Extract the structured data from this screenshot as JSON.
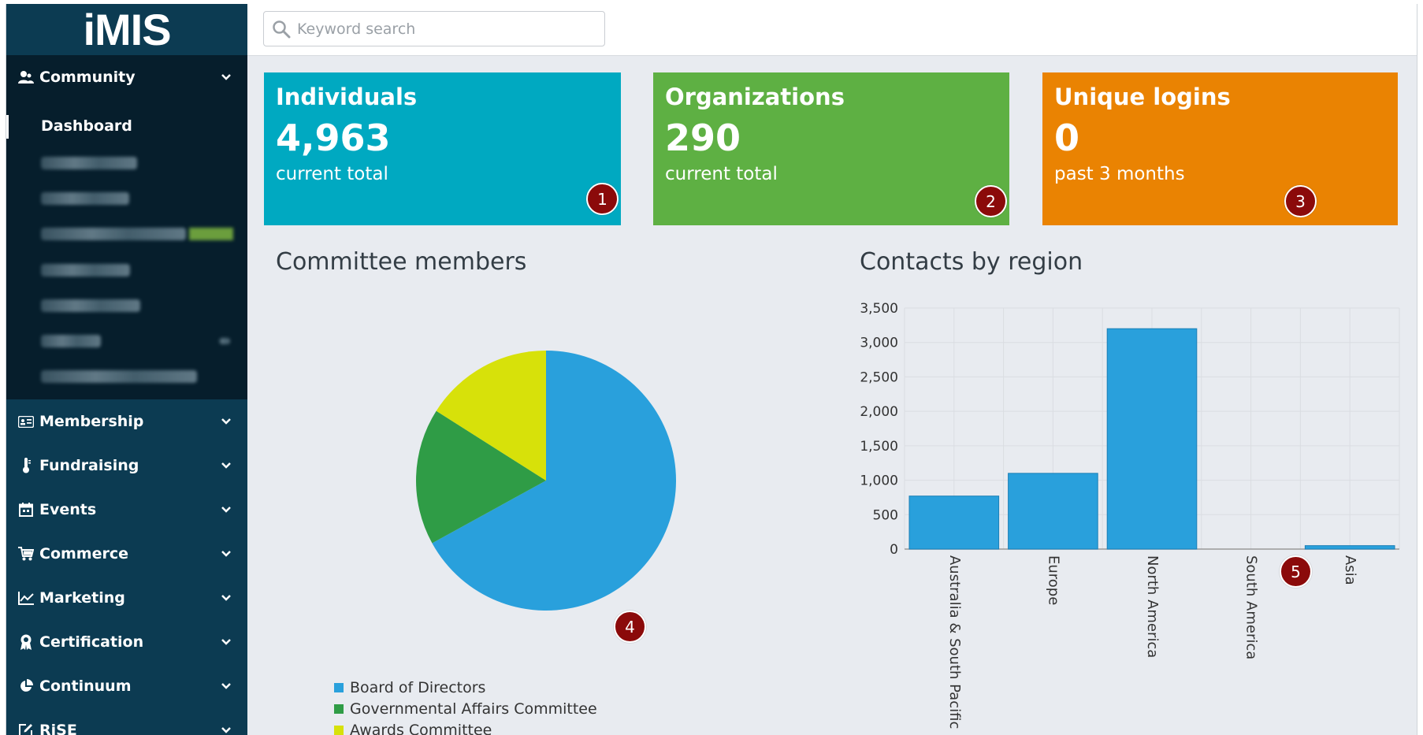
{
  "app": {
    "logo": "iMIS"
  },
  "search": {
    "placeholder": "Keyword search"
  },
  "sidebar": {
    "sections": [
      {
        "label": "Community",
        "icon": "community-icon"
      },
      {
        "label": "Membership",
        "icon": "id-card-icon"
      },
      {
        "label": "Fundraising",
        "icon": "thermometer-icon"
      },
      {
        "label": "Events",
        "icon": "calendar-icon"
      },
      {
        "label": "Commerce",
        "icon": "cart-icon"
      },
      {
        "label": "Marketing",
        "icon": "line-chart-icon"
      },
      {
        "label": "Certification",
        "icon": "award-icon"
      },
      {
        "label": "Continuum",
        "icon": "pie-icon"
      },
      {
        "label": "RiSE",
        "icon": "edit-icon"
      }
    ],
    "community_items": {
      "active": "Dashboard"
    }
  },
  "cards": [
    {
      "title": "Individuals",
      "value": "4,963",
      "subtitle": "current total",
      "color": "#00a9c1",
      "marker": "1"
    },
    {
      "title": "Organizations",
      "value": "290",
      "subtitle": "current total",
      "color": "#5eb043",
      "marker": "2"
    },
    {
      "title": "Unique logins",
      "value": "0",
      "subtitle": "past 3 months",
      "color": "#ea8302",
      "marker": "3"
    }
  ],
  "committee": {
    "title": "Committee members",
    "marker": "4",
    "legend": [
      "Board of Directors",
      "Governmental Affairs Committee",
      "Awards Committee"
    ]
  },
  "region": {
    "title": "Contacts by region",
    "marker": "5"
  },
  "chart_data": [
    {
      "type": "pie",
      "title": "Committee members",
      "categories": [
        "Board of Directors",
        "Governmental Affairs Committee",
        "Awards Committee"
      ],
      "values": [
        67,
        17,
        16
      ],
      "colors": [
        "#29a0dc",
        "#2f9c46",
        "#d7e10a"
      ]
    },
    {
      "type": "bar",
      "title": "Contacts by region",
      "categories": [
        "Australia & South Pacific",
        "Europe",
        "North America",
        "South America",
        "Asia"
      ],
      "values": [
        770,
        1100,
        3200,
        0,
        50
      ],
      "ylim": [
        0,
        3500
      ],
      "yticks": [
        "0",
        "500",
        "1,000",
        "1,500",
        "2,000",
        "2,500",
        "3,000",
        "3,500"
      ],
      "grid": true,
      "color": "#29a0dc"
    }
  ]
}
